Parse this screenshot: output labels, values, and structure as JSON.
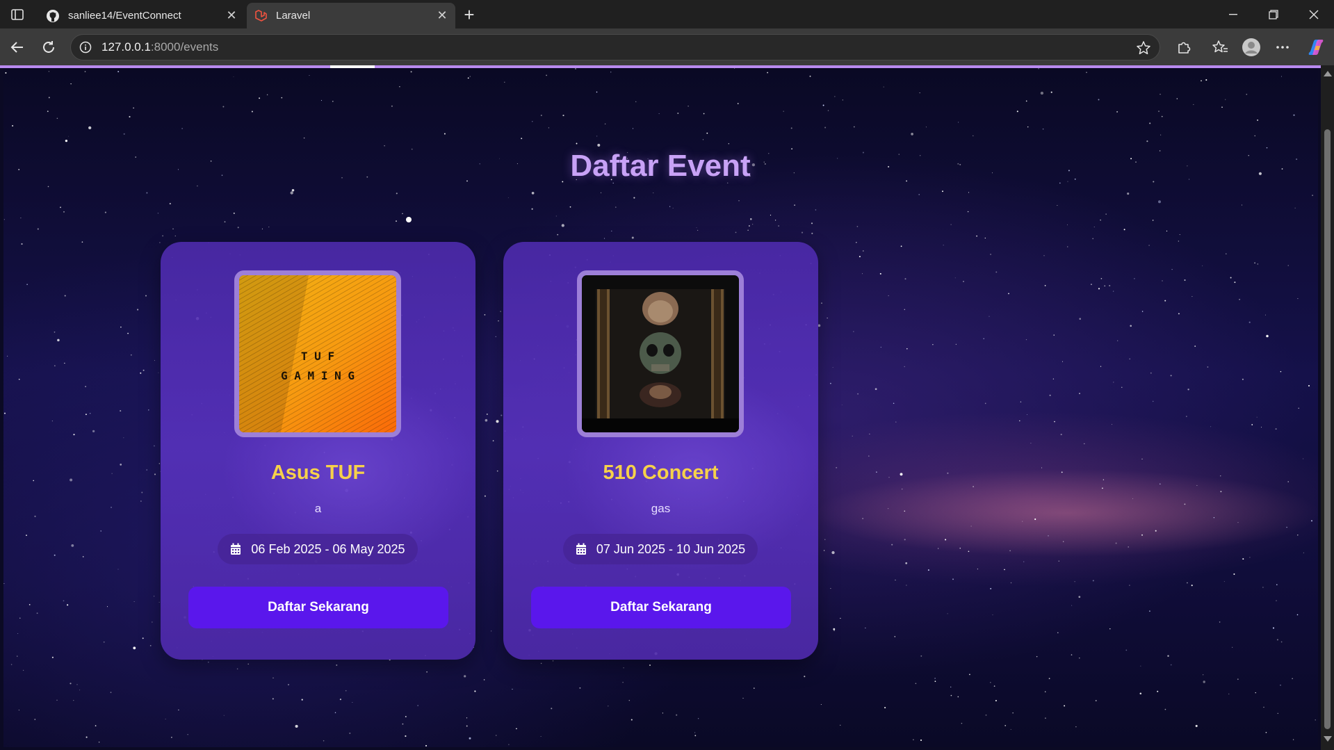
{
  "browser": {
    "tabs": [
      {
        "title": "sanliee14/EventConnect",
        "favicon": "github-icon",
        "active": false
      },
      {
        "title": "Laravel",
        "favicon": "laravel-icon",
        "active": true
      }
    ],
    "url_host": "127.0.0.1",
    "url_path": ":8000/events",
    "icons": {
      "back": "back-arrow-icon",
      "reload": "reload-icon",
      "site_info": "info-icon",
      "bookmark": "star-icon",
      "extensions": "puzzle-icon",
      "favorites": "favorites-icon",
      "profile": "profile-icon",
      "menu": "more-icon",
      "copilot": "copilot-icon"
    }
  },
  "page": {
    "title": "Daftar Event",
    "events": [
      {
        "name": "Asus TUF",
        "description": "a",
        "date_range": "06 Feb 2025 - 06 May 2025",
        "button_label": "Daftar Sekarang",
        "image_text_top": "T U F",
        "image_text_bottom": "G A M I N G"
      },
      {
        "name": "510 Concert",
        "description": "gas",
        "date_range": "07 Jun 2025 - 10 Jun 2025",
        "button_label": "Daftar Sekarang"
      }
    ]
  },
  "colors": {
    "accent_title": "#c8a2f6",
    "event_name": "#f6d14a",
    "button": "#5a17ec",
    "card": "#4c2aaa"
  }
}
